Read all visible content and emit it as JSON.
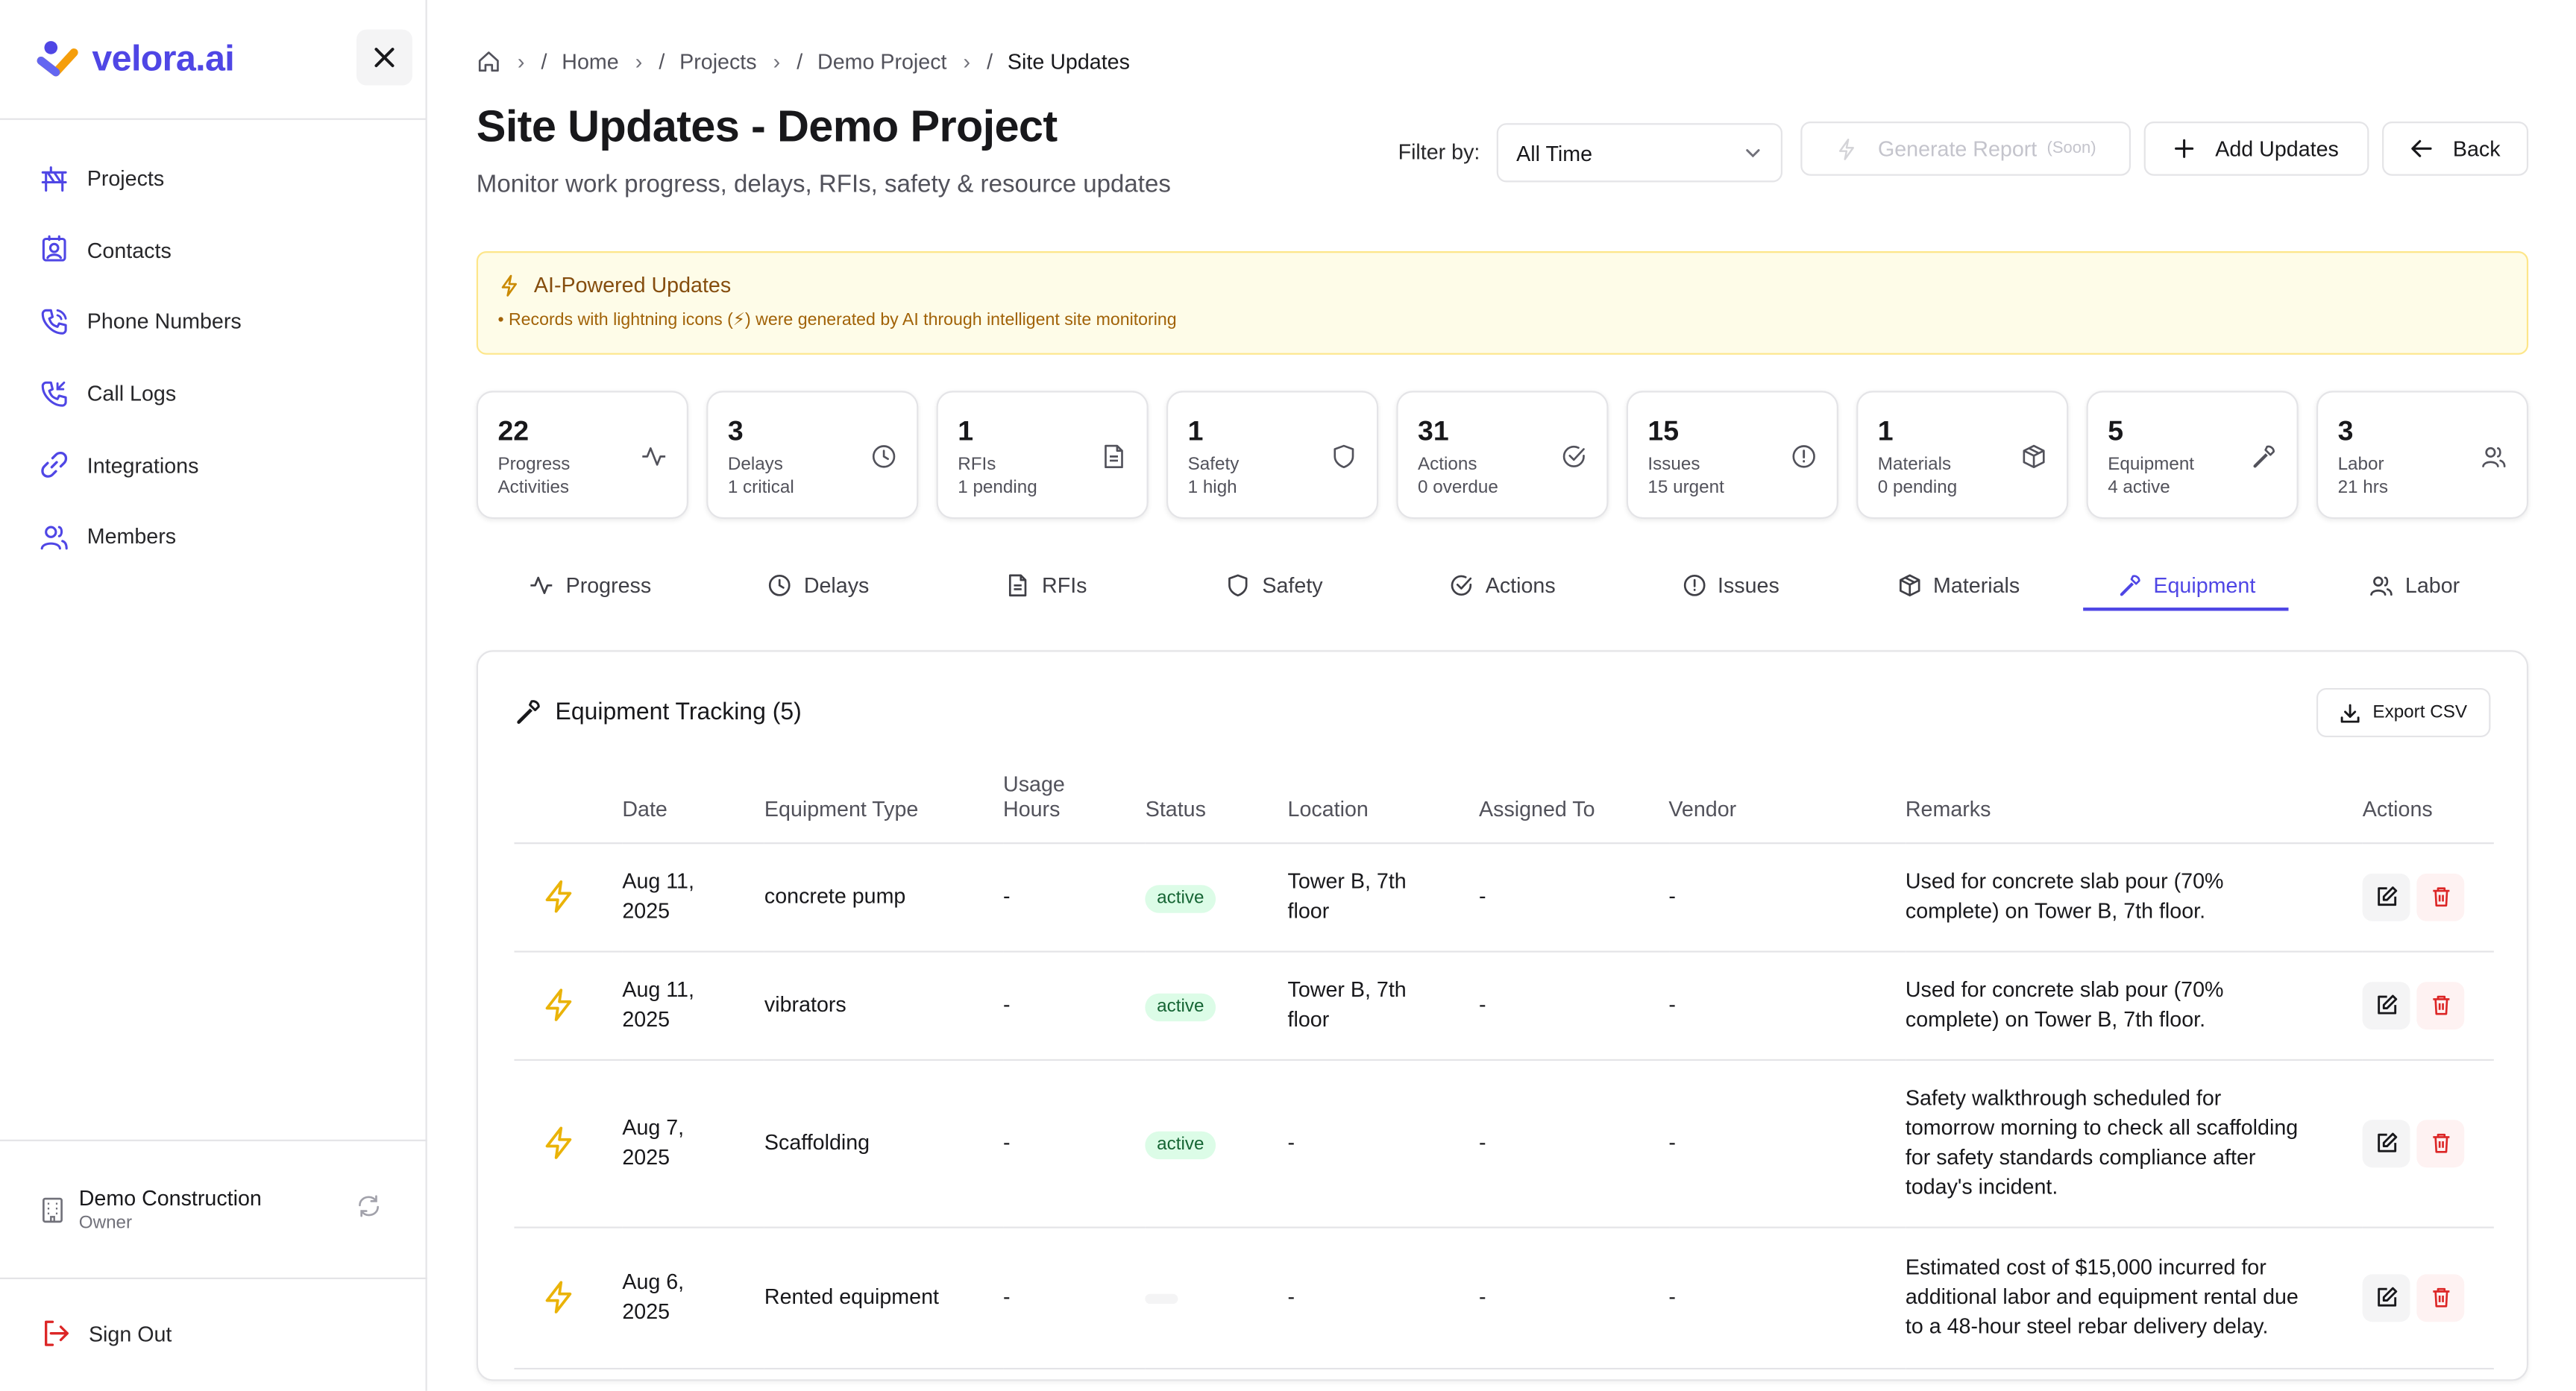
{
  "sidebar": {
    "brand": "velora.ai",
    "items": [
      {
        "label": "Projects",
        "icon": "projects-icon"
      },
      {
        "label": "Contacts",
        "icon": "contacts-icon"
      },
      {
        "label": "Phone Numbers",
        "icon": "phone-icon"
      },
      {
        "label": "Call Logs",
        "icon": "call-logs-icon"
      },
      {
        "label": "Integrations",
        "icon": "link-icon"
      },
      {
        "label": "Members",
        "icon": "members-icon"
      }
    ],
    "org": {
      "name": "Demo Construction",
      "role": "Owner"
    },
    "sign_out": "Sign Out"
  },
  "breadcrumb": {
    "sep": "/",
    "items": [
      "Home",
      "Projects",
      "Demo Project",
      "Site Updates"
    ]
  },
  "page": {
    "title": "Site Updates - Demo Project",
    "subtitle": "Monitor work progress, delays, RFIs, safety & resource updates"
  },
  "toolbar": {
    "filter_label": "Filter by:",
    "filter_value": "All Time",
    "generate_label": "Generate Report",
    "generate_soon": "(Soon)",
    "add_label": "Add Updates",
    "back_label": "Back"
  },
  "ai_banner": {
    "title": "AI-Powered Updates",
    "description": "• Records with lightning icons (⚡) were generated by AI through intelligent site monitoring"
  },
  "stats": [
    {
      "value": "22",
      "label": "Progress",
      "sub": "Activities",
      "icon": "activity-icon"
    },
    {
      "value": "3",
      "label": "Delays",
      "sub": "1 critical",
      "icon": "clock-icon"
    },
    {
      "value": "1",
      "label": "RFIs",
      "sub": "1 pending",
      "icon": "document-icon"
    },
    {
      "value": "1",
      "label": "Safety",
      "sub": "1 high",
      "icon": "shield-icon"
    },
    {
      "value": "31",
      "label": "Actions",
      "sub": "0 overdue",
      "icon": "check-circle-icon"
    },
    {
      "value": "15",
      "label": "Issues",
      "sub": "15 urgent",
      "icon": "alert-circle-icon"
    },
    {
      "value": "1",
      "label": "Materials",
      "sub": "0 pending",
      "icon": "package-icon"
    },
    {
      "value": "5",
      "label": "Equipment",
      "sub": "4 active",
      "icon": "wrench-icon"
    },
    {
      "value": "3",
      "label": "Labor",
      "sub": "21 hrs",
      "icon": "users-icon"
    }
  ],
  "tabs": [
    {
      "label": "Progress",
      "icon": "activity-icon",
      "active": false
    },
    {
      "label": "Delays",
      "icon": "clock-icon",
      "active": false
    },
    {
      "label": "RFIs",
      "icon": "document-icon",
      "active": false
    },
    {
      "label": "Safety",
      "icon": "shield-icon",
      "active": false
    },
    {
      "label": "Actions",
      "icon": "check-circle-icon",
      "active": false
    },
    {
      "label": "Issues",
      "icon": "alert-circle-icon",
      "active": false
    },
    {
      "label": "Materials",
      "icon": "package-icon",
      "active": false
    },
    {
      "label": "Equipment",
      "icon": "wrench-icon",
      "active": true
    },
    {
      "label": "Labor",
      "icon": "users-icon",
      "active": false
    }
  ],
  "equipment": {
    "title": "Equipment Tracking (5)",
    "export_label": "Export CSV",
    "columns": {
      "date": "Date",
      "type": "Equipment Type",
      "hours_1": "Usage",
      "hours_2": "Hours",
      "status": "Status",
      "location": "Location",
      "assigned": "Assigned To",
      "vendor": "Vendor",
      "remarks": "Remarks",
      "actions": "Actions"
    },
    "rows": [
      {
        "date_1": "Aug 11,",
        "date_2": "2025",
        "type": "concrete pump",
        "hours": "-",
        "status": "active",
        "loc_1": "Tower B, 7th",
        "loc_2": "floor",
        "assigned": "-",
        "vendor": "-",
        "remarks": [
          "Used for concrete slab pour (70%",
          "complete) on Tower B, 7th floor."
        ]
      },
      {
        "date_1": "Aug 11,",
        "date_2": "2025",
        "type": "vibrators",
        "hours": "-",
        "status": "active",
        "loc_1": "Tower B, 7th",
        "loc_2": "floor",
        "assigned": "-",
        "vendor": "-",
        "remarks": [
          "Used for concrete slab pour (70%",
          "complete) on Tower B, 7th floor."
        ]
      },
      {
        "date_1": "Aug 7,",
        "date_2": "2025",
        "type": "Scaffolding",
        "hours": "-",
        "status": "active",
        "loc_1": "-",
        "loc_2": "",
        "assigned": "-",
        "vendor": "-",
        "remarks": [
          "Safety walkthrough scheduled for",
          "tomorrow morning to check all scaffolding",
          "for safety standards compliance after",
          "today's incident."
        ]
      },
      {
        "date_1": "Aug 6,",
        "date_2": "2025",
        "type": "Rented equipment",
        "hours": "-",
        "status": "",
        "loc_1": "-",
        "loc_2": "",
        "assigned": "-",
        "vendor": "-",
        "remarks": [
          "Estimated cost of $15,000 incurred for",
          "additional labor and equipment rental due",
          "to a 48-hour steel rebar delivery delay."
        ]
      }
    ]
  },
  "colors": {
    "accent": "#4f46e5",
    "ai_yellow": "#eab308",
    "danger": "#dc2626",
    "success_bg": "#dcfce7"
  }
}
